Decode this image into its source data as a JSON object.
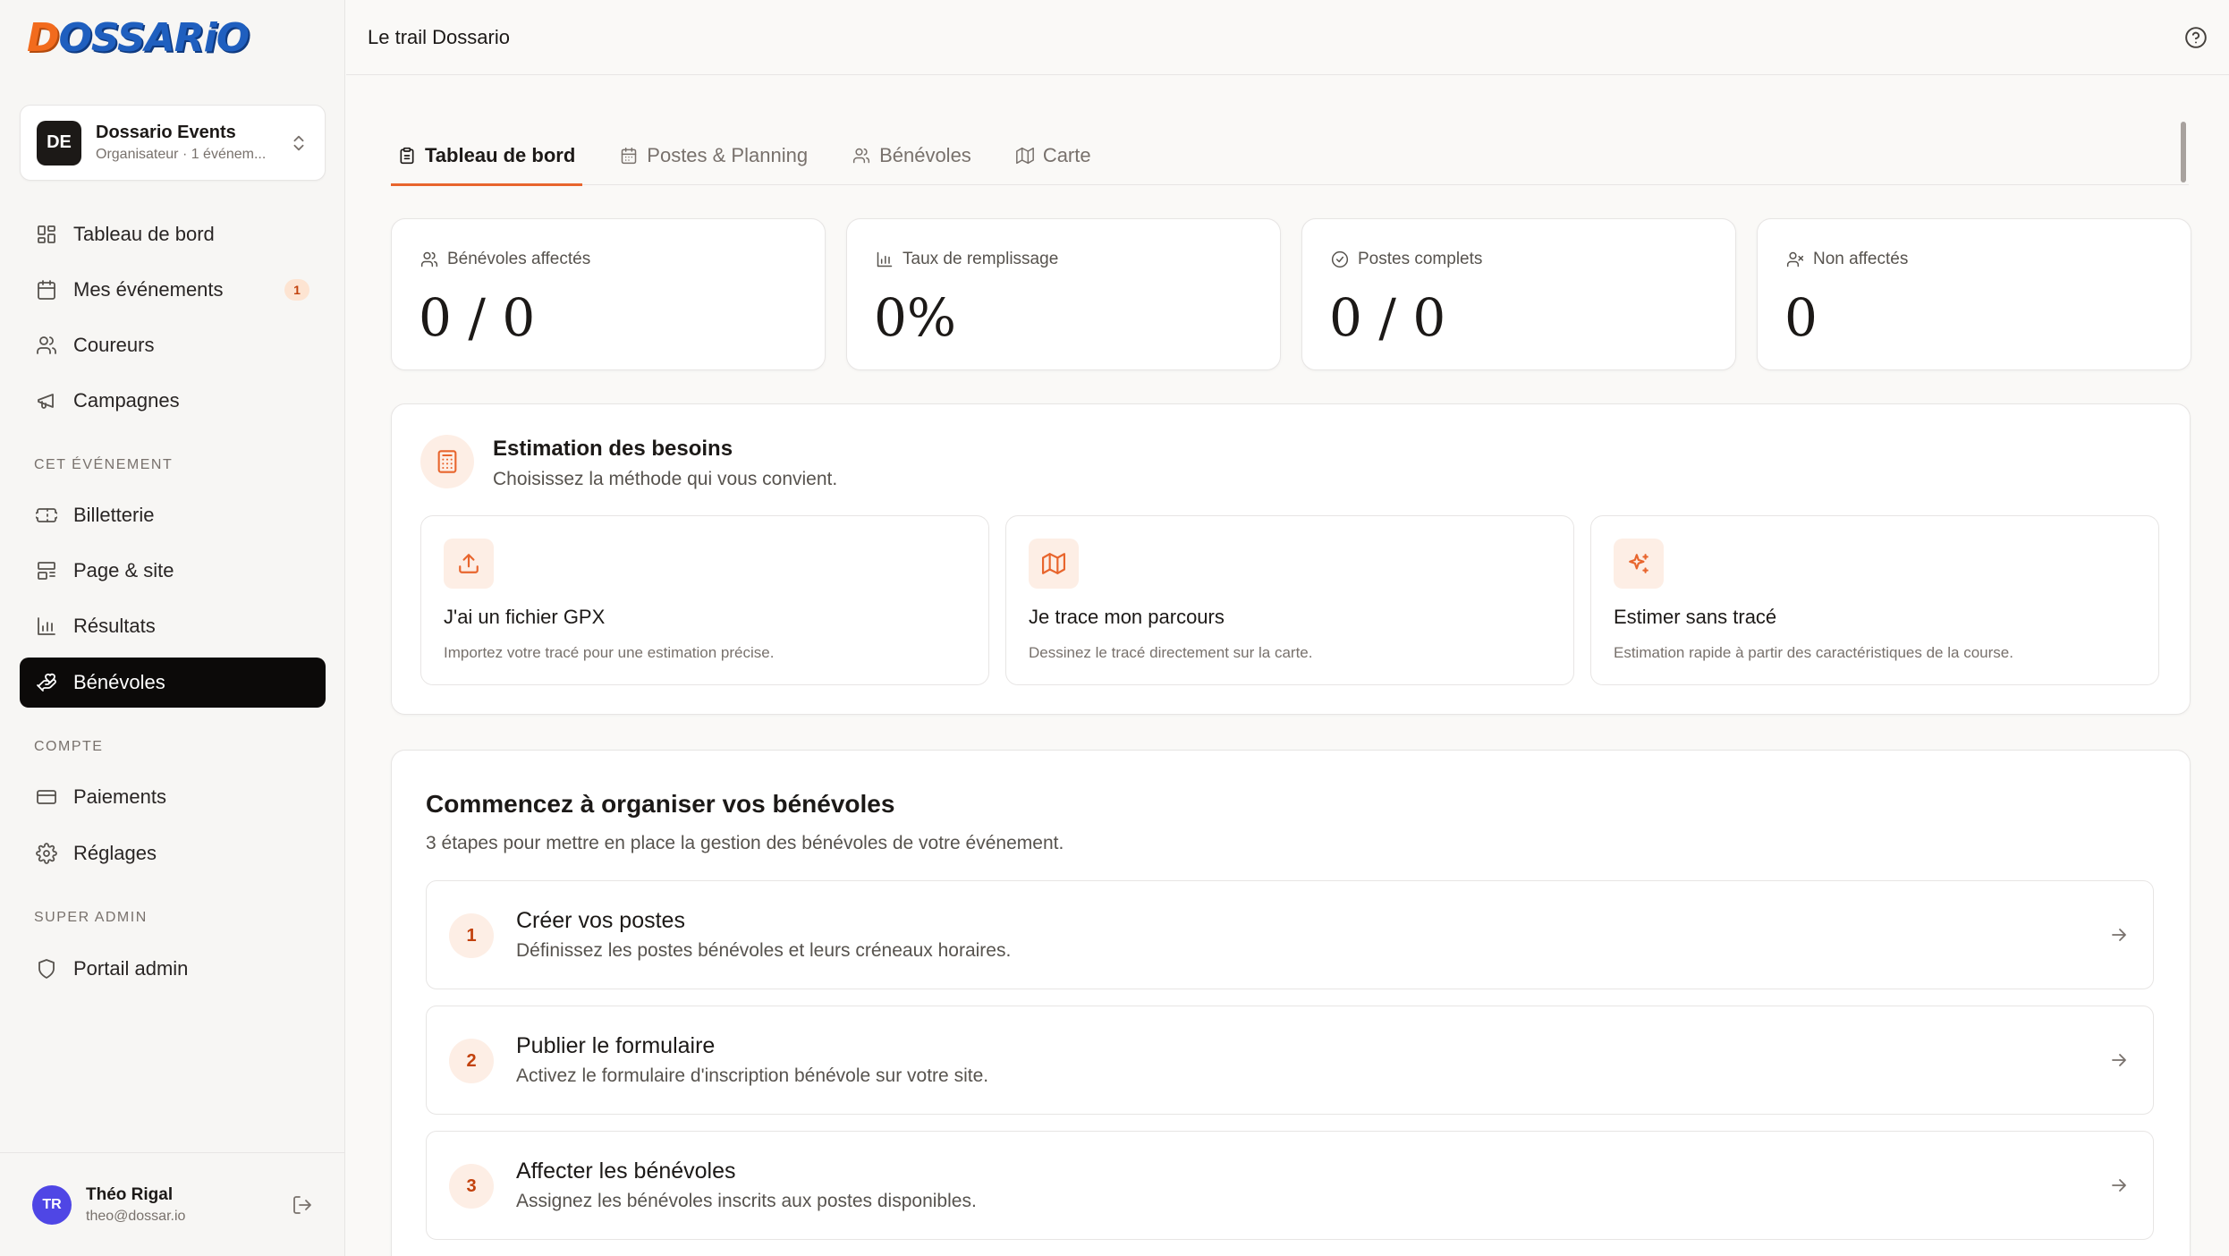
{
  "brand": {
    "logo_text": "DOSSARiO",
    "accent": "#e8652d",
    "logo_blue": "#1f5fbf",
    "logo_orange": "#f26b1d"
  },
  "org": {
    "initials": "DE",
    "name": "Dossario Events",
    "subtitle": "Organisateur · 1 événem..."
  },
  "sidebar": {
    "main_items": [
      {
        "label": "Tableau de bord",
        "icon": "layout-grid-icon"
      },
      {
        "label": "Mes événements",
        "icon": "calendar-icon",
        "badge": "1"
      },
      {
        "label": "Coureurs",
        "icon": "users-icon"
      },
      {
        "label": "Campagnes",
        "icon": "megaphone-icon"
      }
    ],
    "section_event": "CET ÉVÉNEMENT",
    "event_items": [
      {
        "label": "Billetterie",
        "icon": "ticket-icon"
      },
      {
        "label": "Page & site",
        "icon": "layout-icon"
      },
      {
        "label": "Résultats",
        "icon": "bar-chart-icon"
      },
      {
        "label": "Bénévoles",
        "icon": "hand-heart-icon"
      }
    ],
    "section_account": "COMPTE",
    "account_items": [
      {
        "label": "Paiements",
        "icon": "credit-card-icon"
      },
      {
        "label": "Réglages",
        "icon": "gear-icon"
      }
    ],
    "section_admin": "SUPER ADMIN",
    "admin_items": [
      {
        "label": "Portail admin",
        "icon": "shield-icon"
      }
    ]
  },
  "user": {
    "initials": "TR",
    "name": "Théo Rigal",
    "email": "theo@dossar.io"
  },
  "header": {
    "title": "Le trail Dossario"
  },
  "tabs": [
    {
      "label": "Tableau de bord",
      "icon": "clipboard-icon",
      "active": true
    },
    {
      "label": "Postes & Planning",
      "icon": "calendar-icon",
      "active": false
    },
    {
      "label": "Bénévoles",
      "icon": "users-icon",
      "active": false
    },
    {
      "label": "Carte",
      "icon": "map-icon",
      "active": false
    }
  ],
  "stats": [
    {
      "label": "Bénévoles affectés",
      "value": "0 / 0",
      "icon": "users-icon"
    },
    {
      "label": "Taux de remplissage",
      "value": "0%",
      "icon": "bar-chart-icon"
    },
    {
      "label": "Postes complets",
      "value": "0 / 0",
      "icon": "check-circle-icon"
    },
    {
      "label": "Non affectés",
      "value": "0",
      "icon": "user-x-icon"
    }
  ],
  "estimation": {
    "title": "Estimation des besoins",
    "subtitle": "Choisissez la méthode qui vous convient.",
    "options": [
      {
        "title": "J'ai un fichier GPX",
        "desc": "Importez votre tracé pour une estimation précise.",
        "icon": "upload-icon"
      },
      {
        "title": "Je trace mon parcours",
        "desc": "Dessinez le tracé directement sur la carte.",
        "icon": "map-icon"
      },
      {
        "title": "Estimer sans tracé",
        "desc": "Estimation rapide à partir des caractéristiques de la course.",
        "icon": "sparkles-icon"
      }
    ]
  },
  "getting_started": {
    "title": "Commencez à organiser vos bénévoles",
    "subtitle": "3 étapes pour mettre en place la gestion des bénévoles de votre événement.",
    "steps": [
      {
        "num": "1",
        "title": "Créer vos postes",
        "desc": "Définissez les postes bénévoles et leurs créneaux horaires."
      },
      {
        "num": "2",
        "title": "Publier le formulaire",
        "desc": "Activez le formulaire d'inscription bénévole sur votre site."
      },
      {
        "num": "3",
        "title": "Affecter les bénévoles",
        "desc": "Assignez les bénévoles inscrits aux postes disponibles."
      }
    ]
  }
}
